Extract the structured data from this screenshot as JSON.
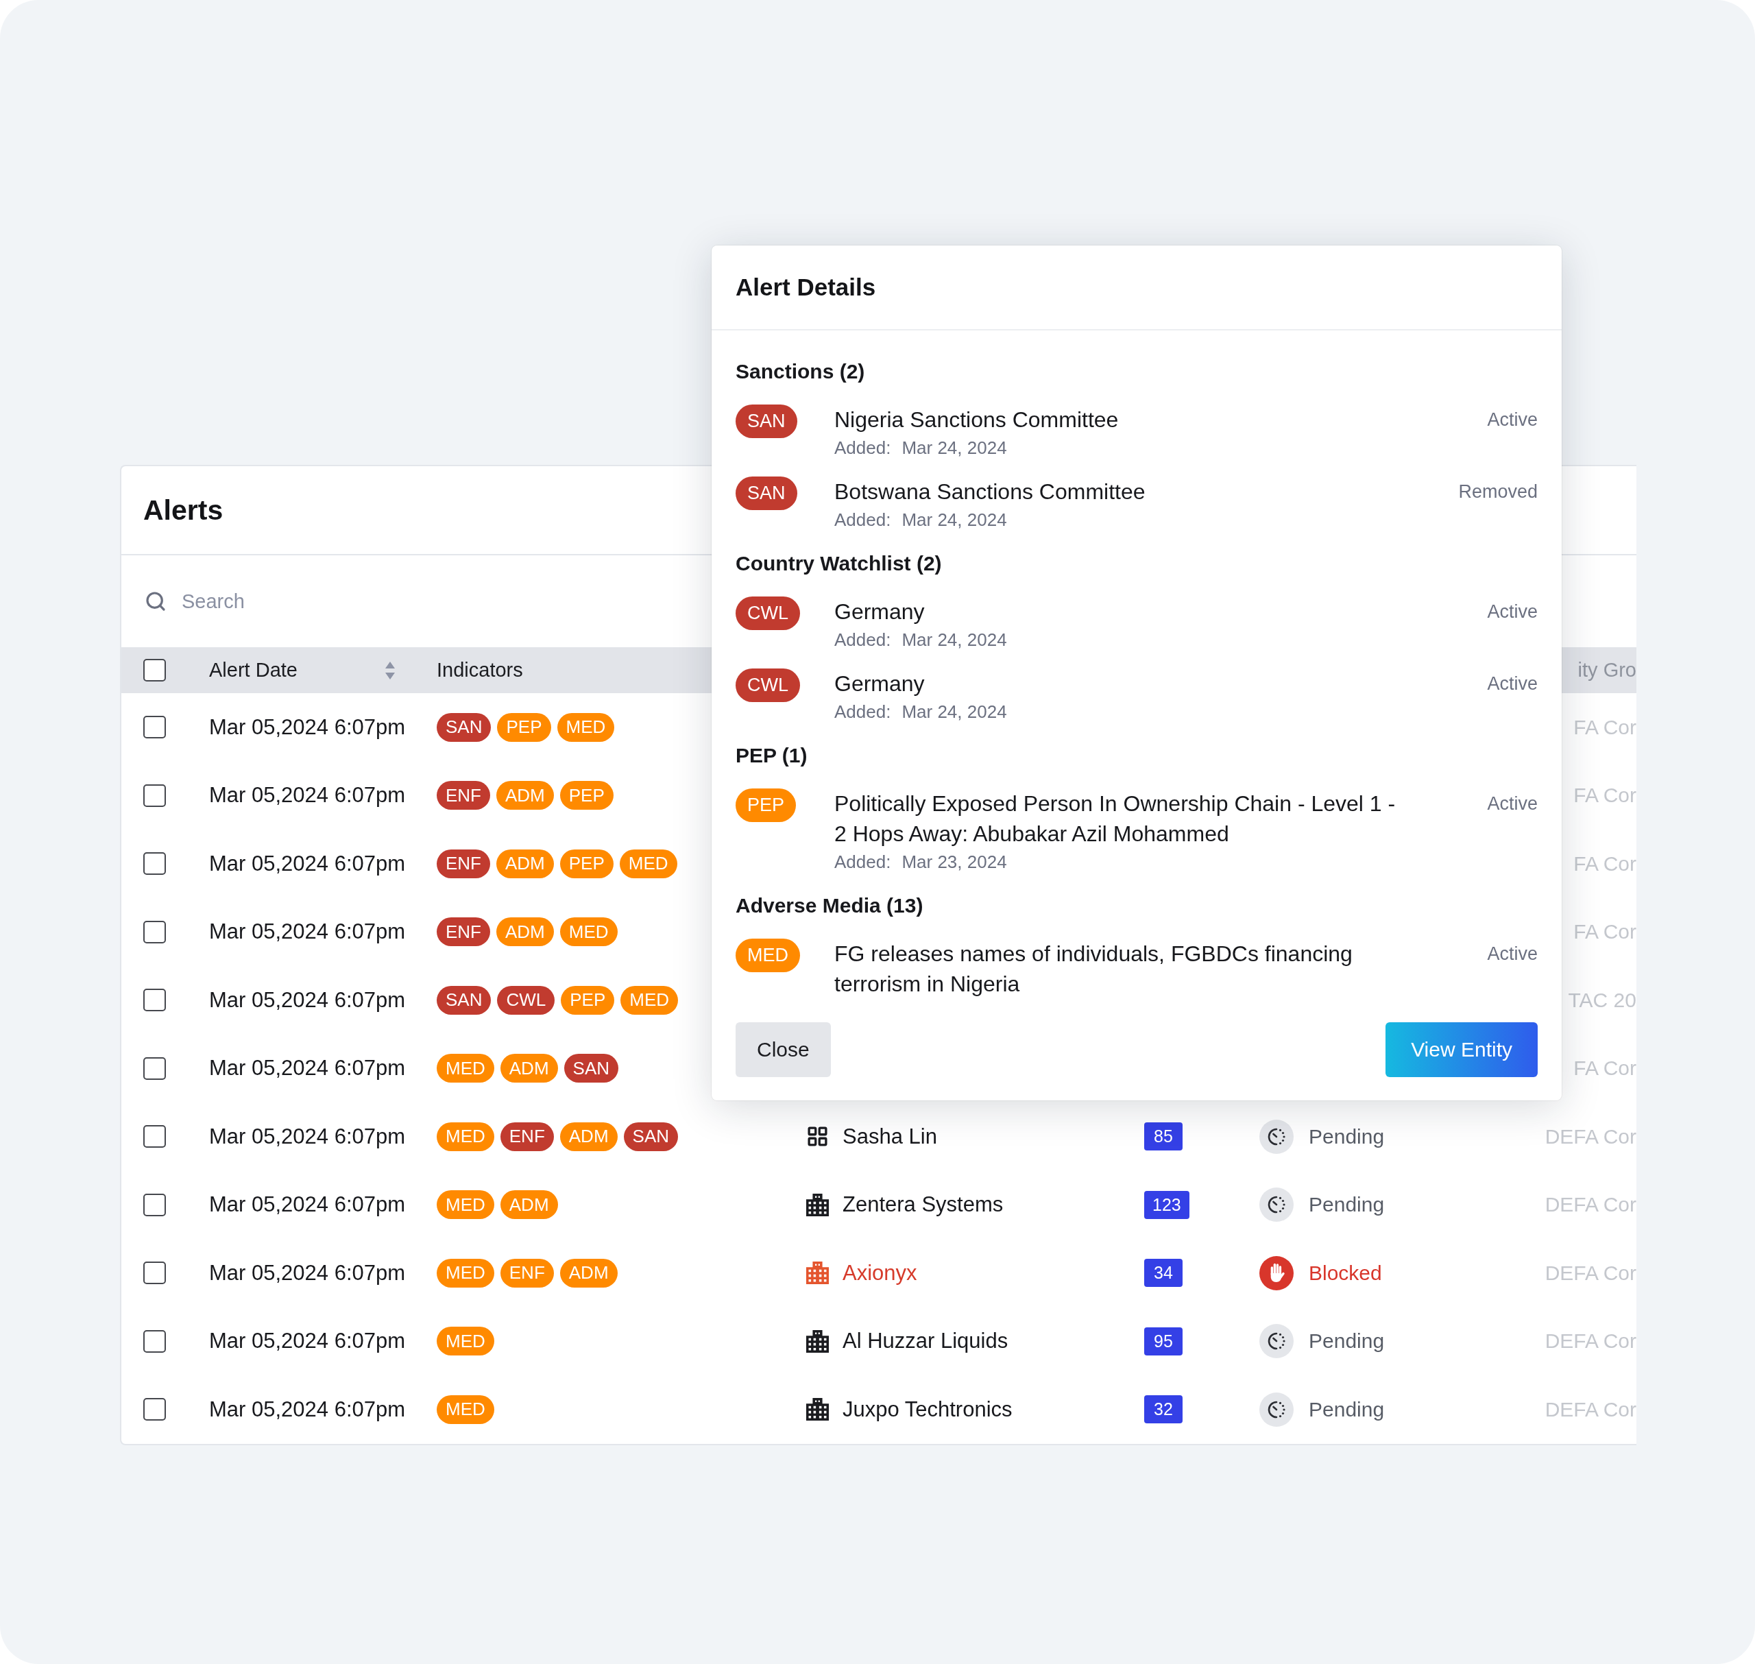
{
  "alerts_panel": {
    "title": "Alerts",
    "search": {
      "placeholder": "Search"
    },
    "table": {
      "select_all": {
        "checked": false
      },
      "columns": [
        {
          "label": "Alert Date",
          "sortable": true
        },
        {
          "label": "Indicators",
          "sortable": false
        },
        {
          "label": "ity Gro",
          "sortable": false
        }
      ],
      "rows": [
        {
          "checked": false,
          "alert_date": "Mar 05,2024 6:07pm",
          "indicators": [
            {
              "label": "SAN",
              "color": "#c13b2f"
            },
            {
              "label": "PEP",
              "color": "#ff8a00"
            },
            {
              "label": "MED",
              "color": "#ff8a00"
            }
          ],
          "column_6": "FA Cor"
        },
        {
          "checked": false,
          "alert_date": "Mar 05,2024 6:07pm",
          "indicators": [
            {
              "label": "ENF",
              "color": "#c13b2f"
            },
            {
              "label": "ADM",
              "color": "#ff8a00"
            },
            {
              "label": "PEP",
              "color": "#ff8a00"
            }
          ],
          "column_6": "FA Cor"
        },
        {
          "checked": false,
          "alert_date": "Mar 05,2024 6:07pm",
          "indicators": [
            {
              "label": "ENF",
              "color": "#c13b2f"
            },
            {
              "label": "ADM",
              "color": "#ff8a00"
            },
            {
              "label": "PEP",
              "color": "#ff8a00"
            },
            {
              "label": "MED",
              "color": "#ff8a00"
            }
          ],
          "column_6": "FA Cor"
        },
        {
          "checked": false,
          "alert_date": "Mar 05,2024 6:07pm",
          "indicators": [
            {
              "label": "ENF",
              "color": "#c13b2f"
            },
            {
              "label": "ADM",
              "color": "#ff8a00"
            },
            {
              "label": "MED",
              "color": "#ff8a00"
            }
          ],
          "column_6": "FA Cor"
        },
        {
          "checked": false,
          "alert_date": "Mar 05,2024 6:07pm",
          "indicators": [
            {
              "label": "SAN",
              "color": "#c13b2f"
            },
            {
              "label": "CWL",
              "color": "#c13b2f"
            },
            {
              "label": "PEP",
              "color": "#ff8a00"
            },
            {
              "label": "MED",
              "color": "#ff8a00"
            }
          ],
          "column_6": "TAC 20"
        },
        {
          "checked": false,
          "alert_date": "Mar 05,2024 6:07pm",
          "indicators": [
            {
              "label": "MED",
              "color": "#ff8a00"
            },
            {
              "label": "ADM",
              "color": "#ff8a00"
            },
            {
              "label": "SAN",
              "color": "#c13b2f"
            }
          ],
          "column_6": "FA Cor"
        },
        {
          "checked": false,
          "alert_date": "Mar 05,2024 6:07pm",
          "indicators": [
            {
              "label": "MED",
              "color": "#ff8a00"
            },
            {
              "label": "ENF",
              "color": "#c13b2f"
            },
            {
              "label": "ADM",
              "color": "#ff8a00"
            },
            {
              "label": "SAN",
              "color": "#c13b2f"
            }
          ],
          "name": {
            "kind": "person",
            "text": "Sasha Lin"
          },
          "column_4": "85",
          "status": {
            "kind": "pending",
            "label": "Pending"
          },
          "column_6": "DEFA Cor"
        },
        {
          "checked": false,
          "alert_date": "Mar 05,2024 6:07pm",
          "indicators": [
            {
              "label": "MED",
              "color": "#ff8a00"
            },
            {
              "label": "ADM",
              "color": "#ff8a00"
            }
          ],
          "name": {
            "kind": "company",
            "text": "Zentera Systems"
          },
          "column_4": "123",
          "status": {
            "kind": "pending",
            "label": "Pending"
          },
          "column_6": "DEFA Cor"
        },
        {
          "checked": false,
          "alert_date": "Mar 05,2024 6:07pm",
          "indicators": [
            {
              "label": "MED",
              "color": "#ff8a00"
            },
            {
              "label": "ENF",
              "color": "#ff8a00"
            },
            {
              "label": "ADM",
              "color": "#ff8a00"
            }
          ],
          "name": {
            "kind": "company",
            "text": "Axionyx"
          },
          "column_4": "34",
          "status": {
            "kind": "blocked",
            "label": "Blocked"
          },
          "column_6": "DEFA Cor"
        },
        {
          "checked": false,
          "alert_date": "Mar 05,2024 6:07pm",
          "indicators": [
            {
              "label": "MED",
              "color": "#ff8a00"
            }
          ],
          "name": {
            "kind": "company",
            "text": "Al Huzzar Liquids"
          },
          "column_4": "95",
          "status": {
            "kind": "pending",
            "label": "Pending"
          },
          "column_6": "DEFA Cor"
        },
        {
          "checked": false,
          "alert_date": "Mar 05,2024 6:07pm",
          "indicators": [
            {
              "label": "MED",
              "color": "#ff8a00"
            }
          ],
          "name": {
            "kind": "company",
            "text": "Juxpo Techtronics"
          },
          "column_4": "32",
          "status": {
            "kind": "pending",
            "label": "Pending"
          },
          "column_6": "DEFA Cor"
        }
      ]
    }
  },
  "alert_details": {
    "title": "Alert Details",
    "sections": [
      {
        "heading": "Sanctions (2)",
        "entries": [
          {
            "indicator": {
              "label": "SAN",
              "color": "#c13b2f"
            },
            "title": "Nigeria Sanctions Committee",
            "added_label": "Added:",
            "added": "Mar 24, 2024",
            "status": "Active"
          },
          {
            "indicator": {
              "label": "SAN",
              "color": "#c13b2f"
            },
            "title": "Botswana Sanctions Committee",
            "added_label": "Added:",
            "added": "Mar 24, 2024",
            "status": "Removed"
          }
        ]
      },
      {
        "heading": "Country Watchlist (2)",
        "entries": [
          {
            "indicator": {
              "label": "CWL",
              "color": "#c13b2f"
            },
            "title": "Germany",
            "added_label": "Added:",
            "added": "Mar 24, 2024",
            "status": "Active"
          },
          {
            "indicator": {
              "label": "CWL",
              "color": "#c13b2f"
            },
            "title": "Germany",
            "added_label": "Added:",
            "added": "Mar 24, 2024",
            "status": "Active"
          }
        ]
      },
      {
        "heading": "PEP (1)",
        "entries": [
          {
            "indicator": {
              "label": "PEP",
              "color": "#ff8a00"
            },
            "title": "Politically Exposed Person In Ownership Chain - Level 1 - 2 Hops Away: Abubakar Azil Mohammed",
            "added_label": "Added:",
            "added": "Mar 23, 2024",
            "status": "Active"
          }
        ]
      },
      {
        "heading": "Adverse Media (13)",
        "entries": [
          {
            "indicator": {
              "label": "MED",
              "color": "#ff8a00"
            },
            "title": "FG releases names of individuals, FGBDCs financing terrorism in Nigeria",
            "status": "Active"
          }
        ]
      }
    ],
    "buttons": [
      {
        "label": "Close",
        "kind": "secondary"
      },
      {
        "label": "View Entity",
        "kind": "primary"
      }
    ]
  }
}
